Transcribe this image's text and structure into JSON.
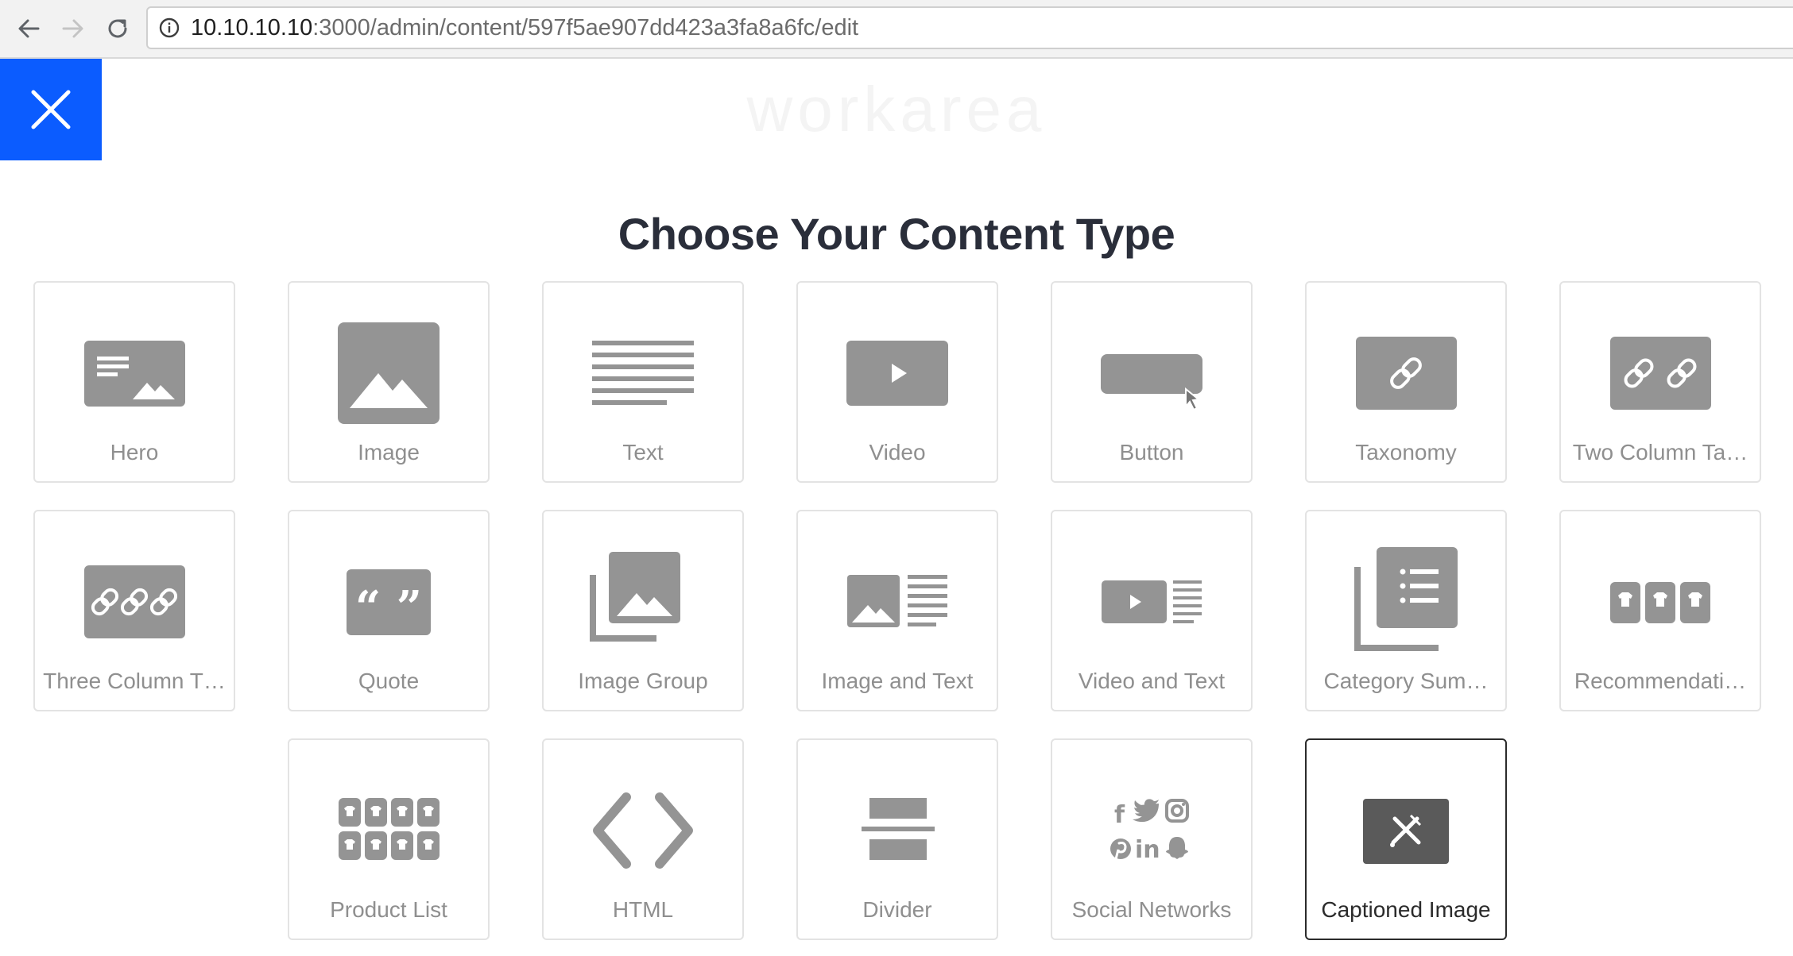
{
  "browser": {
    "url_host": "10.10.10.10",
    "url_path": ":3000/admin/content/597f5ae907dd423a3fa8a6fc/edit"
  },
  "app": {
    "brand": "workarea",
    "page_title": "Choose Your Content Type",
    "accent_color": "#0b5cff"
  },
  "content_types": [
    {
      "label": "Hero",
      "icon": "hero-icon",
      "selected": false
    },
    {
      "label": "Image",
      "icon": "image-icon",
      "selected": false
    },
    {
      "label": "Text",
      "icon": "text-icon",
      "selected": false
    },
    {
      "label": "Video",
      "icon": "video-icon",
      "selected": false
    },
    {
      "label": "Button",
      "icon": "button-icon",
      "selected": false
    },
    {
      "label": "Taxonomy",
      "icon": "link-icon",
      "selected": false
    },
    {
      "label": "Two Column Ta…",
      "icon": "two-links-icon",
      "selected": false
    },
    {
      "label": "Three Column T…",
      "icon": "three-links-icon",
      "selected": false
    },
    {
      "label": "Quote",
      "icon": "quote-icon",
      "selected": false
    },
    {
      "label": "Image Group",
      "icon": "image-group-icon",
      "selected": false
    },
    {
      "label": "Image and Text",
      "icon": "image-text-icon",
      "selected": false
    },
    {
      "label": "Video and Text",
      "icon": "video-text-icon",
      "selected": false
    },
    {
      "label": "Category Sum…",
      "icon": "category-summary-icon",
      "selected": false
    },
    {
      "label": "Recommendati…",
      "icon": "recommendations-icon",
      "selected": false
    },
    {
      "label": "Product List",
      "icon": "product-list-icon",
      "selected": false
    },
    {
      "label": "HTML",
      "icon": "code-icon",
      "selected": false
    },
    {
      "label": "Divider",
      "icon": "divider-icon",
      "selected": false
    },
    {
      "label": "Social Networks",
      "icon": "social-networks-icon",
      "selected": false
    },
    {
      "label": "Captioned Image",
      "icon": "captioned-image-icon",
      "selected": true
    }
  ]
}
